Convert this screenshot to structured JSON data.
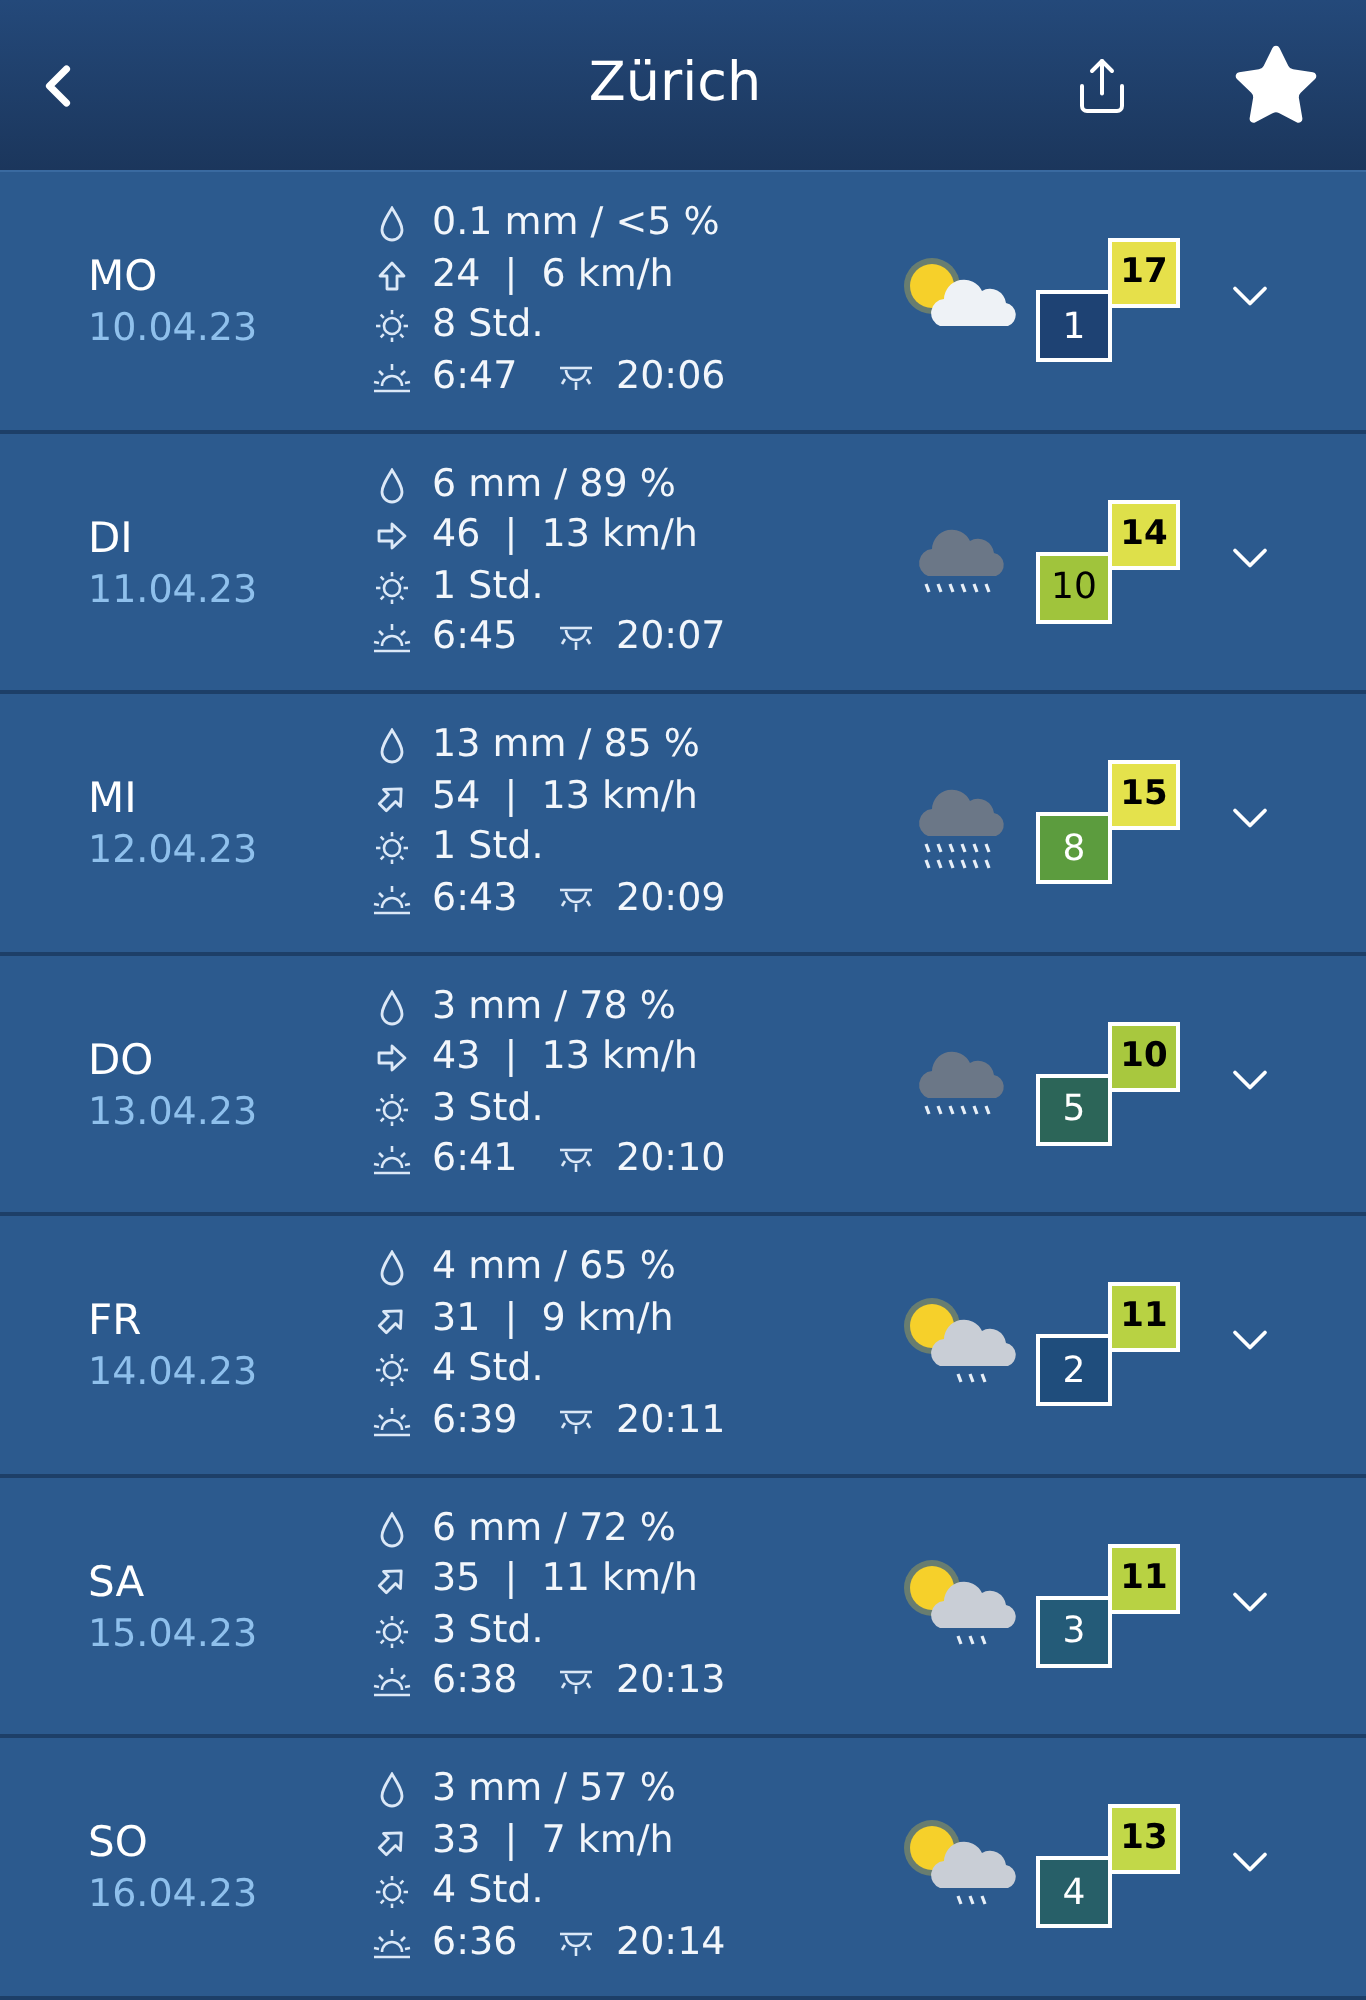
{
  "header": {
    "title": "Zürich"
  },
  "days": [
    {
      "day": "MO",
      "date": "10.04.23",
      "rain": "0.1 mm / <5 %",
      "wind_arrow": {
        "kind": "n"
      },
      "wind": "24  |  6 km/h",
      "sunshine": "8 Std.",
      "sunrise": "6:47",
      "sunset": "20:06",
      "weather": {
        "kind": "sun-cloud"
      },
      "min": {
        "text": "1",
        "color": "#1e4273"
      },
      "max": {
        "text": "17",
        "color": "#e6e04a"
      }
    },
    {
      "day": "DI",
      "date": "11.04.23",
      "rain": "6 mm / 89 %",
      "wind_arrow": {
        "kind": "e"
      },
      "wind": "46  |  13 km/h",
      "sunshine": "1 Std.",
      "sunrise": "6:45",
      "sunset": "20:07",
      "weather": {
        "kind": "rain"
      },
      "min": {
        "text": "10",
        "color": "#a0c43c"
      },
      "max": {
        "text": "14",
        "color": "#dee04a"
      }
    },
    {
      "day": "MI",
      "date": "12.04.23",
      "rain": "13 mm / 85 %",
      "wind_arrow": {
        "kind": "ne"
      },
      "wind": "54  |  13 km/h",
      "sunshine": "1 Std.",
      "sunrise": "6:43",
      "sunset": "20:09",
      "weather": {
        "kind": "heavy-rain"
      },
      "min": {
        "text": "8",
        "color": "#5c9c3e"
      },
      "max": {
        "text": "15",
        "color": "#e4e24c"
      }
    },
    {
      "day": "DO",
      "date": "13.04.23",
      "rain": "3 mm / 78 %",
      "wind_arrow": {
        "kind": "e"
      },
      "wind": "43  |  13 km/h",
      "sunshine": "3 Std.",
      "sunrise": "6:41",
      "sunset": "20:10",
      "weather": {
        "kind": "rain"
      },
      "min": {
        "text": "5",
        "color": "#2c6558"
      },
      "max": {
        "text": "10",
        "color": "#a8c83e"
      }
    },
    {
      "day": "FR",
      "date": "14.04.23",
      "rain": "4 mm / 65 %",
      "wind_arrow": {
        "kind": "ne"
      },
      "wind": "31  |  9 km/h",
      "sunshine": "4 Std.",
      "sunrise": "6:39",
      "sunset": "20:11",
      "weather": {
        "kind": "sun-cloud-rain"
      },
      "min": {
        "text": "2",
        "color": "#1f4d7c"
      },
      "max": {
        "text": "11",
        "color": "#b8d243"
      }
    },
    {
      "day": "SA",
      "date": "15.04.23",
      "rain": "6 mm / 72 %",
      "wind_arrow": {
        "kind": "ne"
      },
      "wind": "35  |  11 km/h",
      "sunshine": "3 Std.",
      "sunrise": "6:38",
      "sunset": "20:13",
      "weather": {
        "kind": "sun-cloud-rain"
      },
      "min": {
        "text": "3",
        "color": "#245b78"
      },
      "max": {
        "text": "11",
        "color": "#b8d243"
      }
    },
    {
      "day": "SO",
      "date": "16.04.23",
      "rain": "3 mm / 57 %",
      "wind_arrow": {
        "kind": "ne"
      },
      "wind": "33  |  7 km/h",
      "sunshine": "4 Std.",
      "sunrise": "6:36",
      "sunset": "20:14",
      "weather": {
        "kind": "sun-cloud-rain"
      },
      "min": {
        "text": "4",
        "color": "#275f68"
      },
      "max": {
        "text": "13",
        "color": "#c2d848"
      }
    }
  ]
}
